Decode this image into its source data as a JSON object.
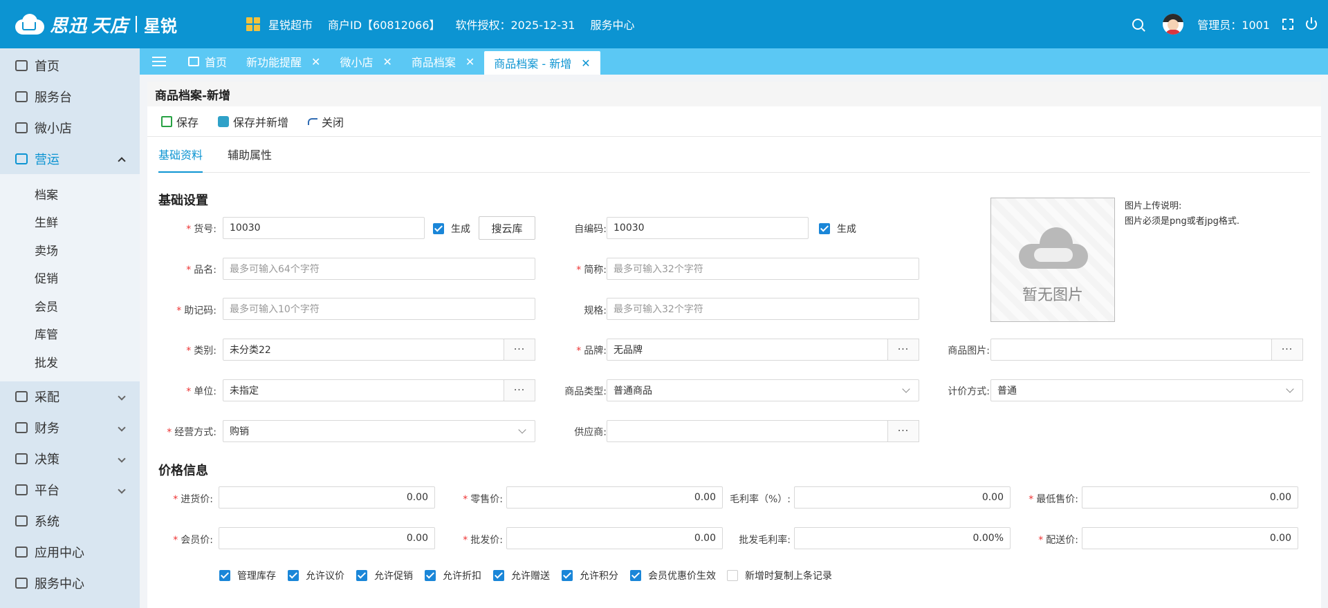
{
  "header": {
    "logo_text": "思迅",
    "logo_text2": "天店",
    "logo_sub": "星锐",
    "store": "星锐超市",
    "merchant": "商户ID【60812066】",
    "license": "软件授权：2025-12-31",
    "service": "服务中心",
    "admin": "管理员：1001"
  },
  "sidebar": {
    "items": [
      {
        "label": "首页"
      },
      {
        "label": "服务台"
      },
      {
        "label": "微小店"
      },
      {
        "label": "营运"
      }
    ],
    "sub_items": [
      "档案",
      "生鲜",
      "卖场",
      "促销",
      "会员",
      "库管",
      "批发"
    ],
    "bottom_items": [
      {
        "label": "采配"
      },
      {
        "label": "财务"
      },
      {
        "label": "决策"
      },
      {
        "label": "平台"
      },
      {
        "label": "系统"
      },
      {
        "label": "应用中心"
      },
      {
        "label": "服务中心"
      }
    ]
  },
  "tabs": [
    {
      "label": "首页"
    },
    {
      "label": "新功能提醒"
    },
    {
      "label": "微小店"
    },
    {
      "label": "商品档案"
    },
    {
      "label": "商品档案 - 新增"
    }
  ],
  "page": {
    "title": "商品档案-新增",
    "toolbar": {
      "save": "保存",
      "save_new": "保存并新增",
      "close": "关闭"
    },
    "subtabs": [
      "基础资料",
      "辅助属性"
    ]
  },
  "basic": {
    "section": "基础设置",
    "item_no_label": "货号:",
    "item_no": "10030",
    "generate": "生成",
    "search_cloud": "搜云库",
    "self_code_label": "自编码:",
    "self_code": "10030",
    "generate2": "生成",
    "name_label": "品名:",
    "name_ph": "最多可输入64个字符",
    "short_label": "简称:",
    "short_ph": "最多可输入32个字符",
    "mnemonic_label": "助记码:",
    "mnemonic_ph": "最多可输入10个字符",
    "spec_label": "规格:",
    "spec_ph": "最多可输入32个字符",
    "category_label": "类别:",
    "category": "未分类22",
    "brand_label": "品牌:",
    "brand": "无品牌",
    "image_label": "商品图片:",
    "unit_label": "单位:",
    "unit": "未指定",
    "goods_type_label": "商品类型:",
    "goods_type": "普通商品",
    "pricing_label": "计价方式:",
    "pricing": "普通",
    "mode_label": "经营方式:",
    "mode": "购销",
    "supplier_label": "供应商:",
    "dots": "···",
    "img_none": "暂无图片",
    "img_note1": "图片上传说明:",
    "img_note2": "图片必须是png或者jpg格式."
  },
  "price": {
    "section": "价格信息",
    "purchase_label": "进货价:",
    "purchase": "0.00",
    "retail_label": "零售价:",
    "retail": "0.00",
    "margin_label": "毛利率（%）:",
    "margin": "0.00",
    "min_label": "最低售价:",
    "min": "0.00",
    "member_label": "会员价:",
    "member": "0.00",
    "wholesale_label": "批发价:",
    "wholesale": "0.00",
    "wmargin_label": "批发毛利率:",
    "wmargin": "0.00%",
    "delivery_label": "配送价:",
    "delivery": "0.00"
  },
  "options": [
    {
      "label": "管理库存",
      "checked": true
    },
    {
      "label": "允许议价",
      "checked": true
    },
    {
      "label": "允许促销",
      "checked": true
    },
    {
      "label": "允许折扣",
      "checked": true
    },
    {
      "label": "允许赠送",
      "checked": true
    },
    {
      "label": "允许积分",
      "checked": true
    },
    {
      "label": "会员优惠价生效",
      "checked": true
    },
    {
      "label": "新增时复制上条记录",
      "checked": false
    }
  ],
  "colors": {
    "primary": "#0c94d2",
    "tab_bar": "#5bc8f4",
    "sidebar": "#d9e6f1",
    "required": "#e33333"
  }
}
